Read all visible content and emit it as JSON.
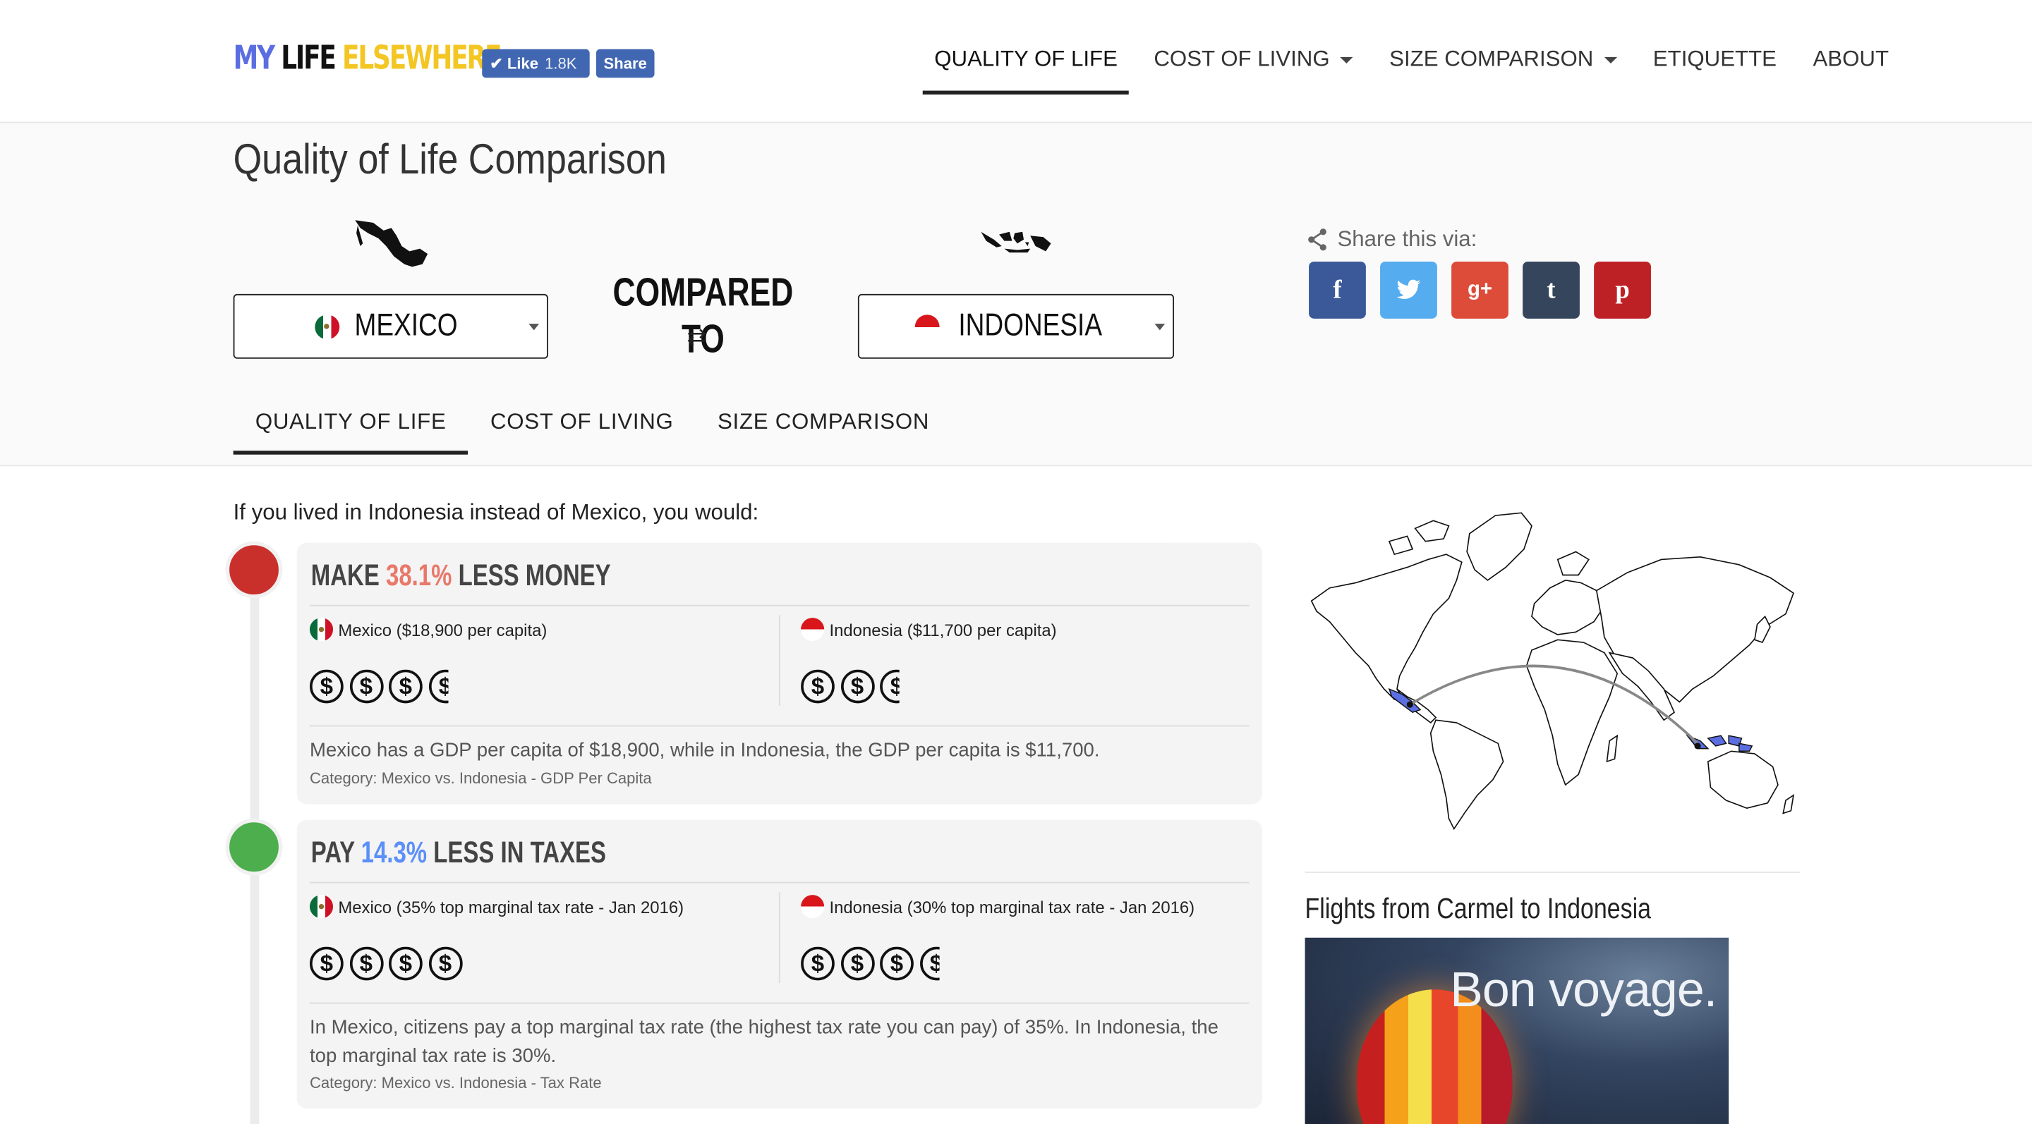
{
  "header": {
    "logo": {
      "part1": "MY",
      "part2": "LIFE",
      "part3": "ELSEWHERE"
    },
    "fb_like": {
      "label": "Like",
      "count": "1.8K"
    },
    "fb_share": "Share",
    "nav": [
      {
        "label": "QUALITY OF LIFE",
        "active": true
      },
      {
        "label": "COST OF LIVING",
        "dropdown": true
      },
      {
        "label": "SIZE COMPARISON",
        "dropdown": true
      },
      {
        "label": "ETIQUETTE"
      },
      {
        "label": "ABOUT"
      }
    ]
  },
  "page": {
    "title": "Quality of Life Comparison",
    "country_a": "MEXICO",
    "country_b": "INDONESIA",
    "compared_to": "COMPARED TO",
    "swap_icon": "⇄",
    "share_label": "Share this via:",
    "share": [
      {
        "icon": "f",
        "color": "#3b5998"
      },
      {
        "icon": "t",
        "color": "#55acee"
      },
      {
        "icon": "g+",
        "color": "#dd4b39"
      },
      {
        "icon": "t",
        "color": "#35465c"
      },
      {
        "icon": "p",
        "color": "#bd2126"
      }
    ],
    "tabs": [
      "QUALITY OF LIFE",
      "COST OF LIVING",
      "SIZE COMPARISON"
    ]
  },
  "content": {
    "intro": "If you lived in Indonesia instead of Mexico, you would:",
    "cards": [
      {
        "dot_color": "#c9302c",
        "head_pre": "MAKE",
        "head_value": "38.1%",
        "head_value_color": "#e8786a",
        "head_post": "LESS MONEY",
        "left_text": "Mexico ($18,900 per capita)",
        "right_text": "Indonesia ($11,700 per capita)",
        "left_coins": 3.5,
        "right_coins": 2.5,
        "desc": "Mexico has a GDP per capita of $18,900, while in Indonesia, the GDP per capita is $11,700.",
        "category": "Category: Mexico vs. Indonesia - GDP Per Capita"
      },
      {
        "dot_color": "#4cae4c",
        "head_pre": "PAY",
        "head_value": "14.3%",
        "head_value_color": "#5b8ff9",
        "head_post": "LESS IN TAXES",
        "left_text": "Mexico (35% top marginal tax rate - Jan 2016)",
        "right_text": "Indonesia (30% top marginal tax rate - Jan 2016)",
        "left_coins": 4,
        "right_coins": 3.5,
        "desc": "In Mexico, citizens pay a top marginal tax rate (the highest tax rate you can pay) of 35%. In Indonesia, the top marginal tax rate is 30%.",
        "category": "Category: Mexico vs. Indonesia - Tax Rate"
      }
    ]
  },
  "sidebar": {
    "flights_title": "Flights from Carmel to Indonesia",
    "ad_text": "Bon voyage."
  }
}
